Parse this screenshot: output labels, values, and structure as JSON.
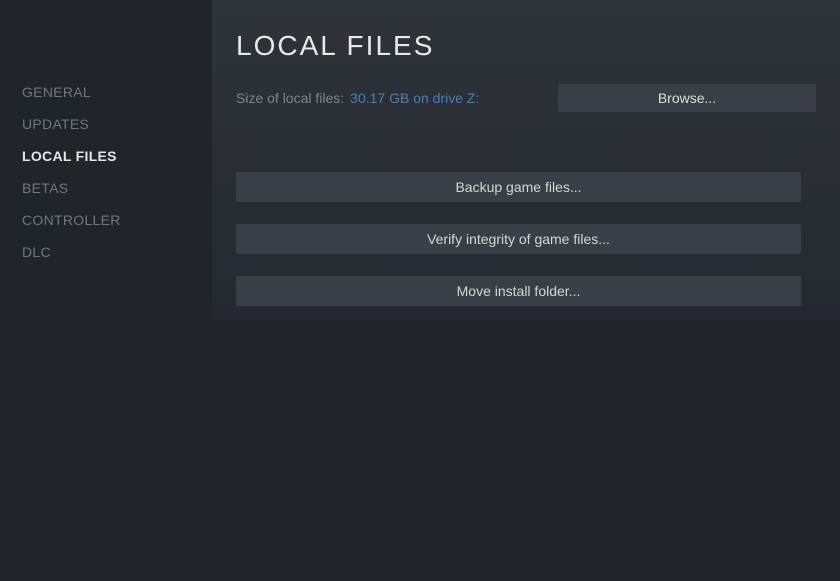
{
  "sidebar": {
    "items": [
      {
        "label": "GENERAL",
        "active": false
      },
      {
        "label": "UPDATES",
        "active": false
      },
      {
        "label": "LOCAL FILES",
        "active": true
      },
      {
        "label": "BETAS",
        "active": false
      },
      {
        "label": "CONTROLLER",
        "active": false
      },
      {
        "label": "DLC",
        "active": false
      }
    ]
  },
  "main": {
    "title": "LOCAL FILES",
    "size_label": "Size of local files:",
    "size_value": "30.17 GB on drive Z:",
    "browse_label": "Browse...",
    "actions": {
      "backup": "Backup game files...",
      "verify": "Verify integrity of game files...",
      "move": "Move install folder..."
    }
  }
}
